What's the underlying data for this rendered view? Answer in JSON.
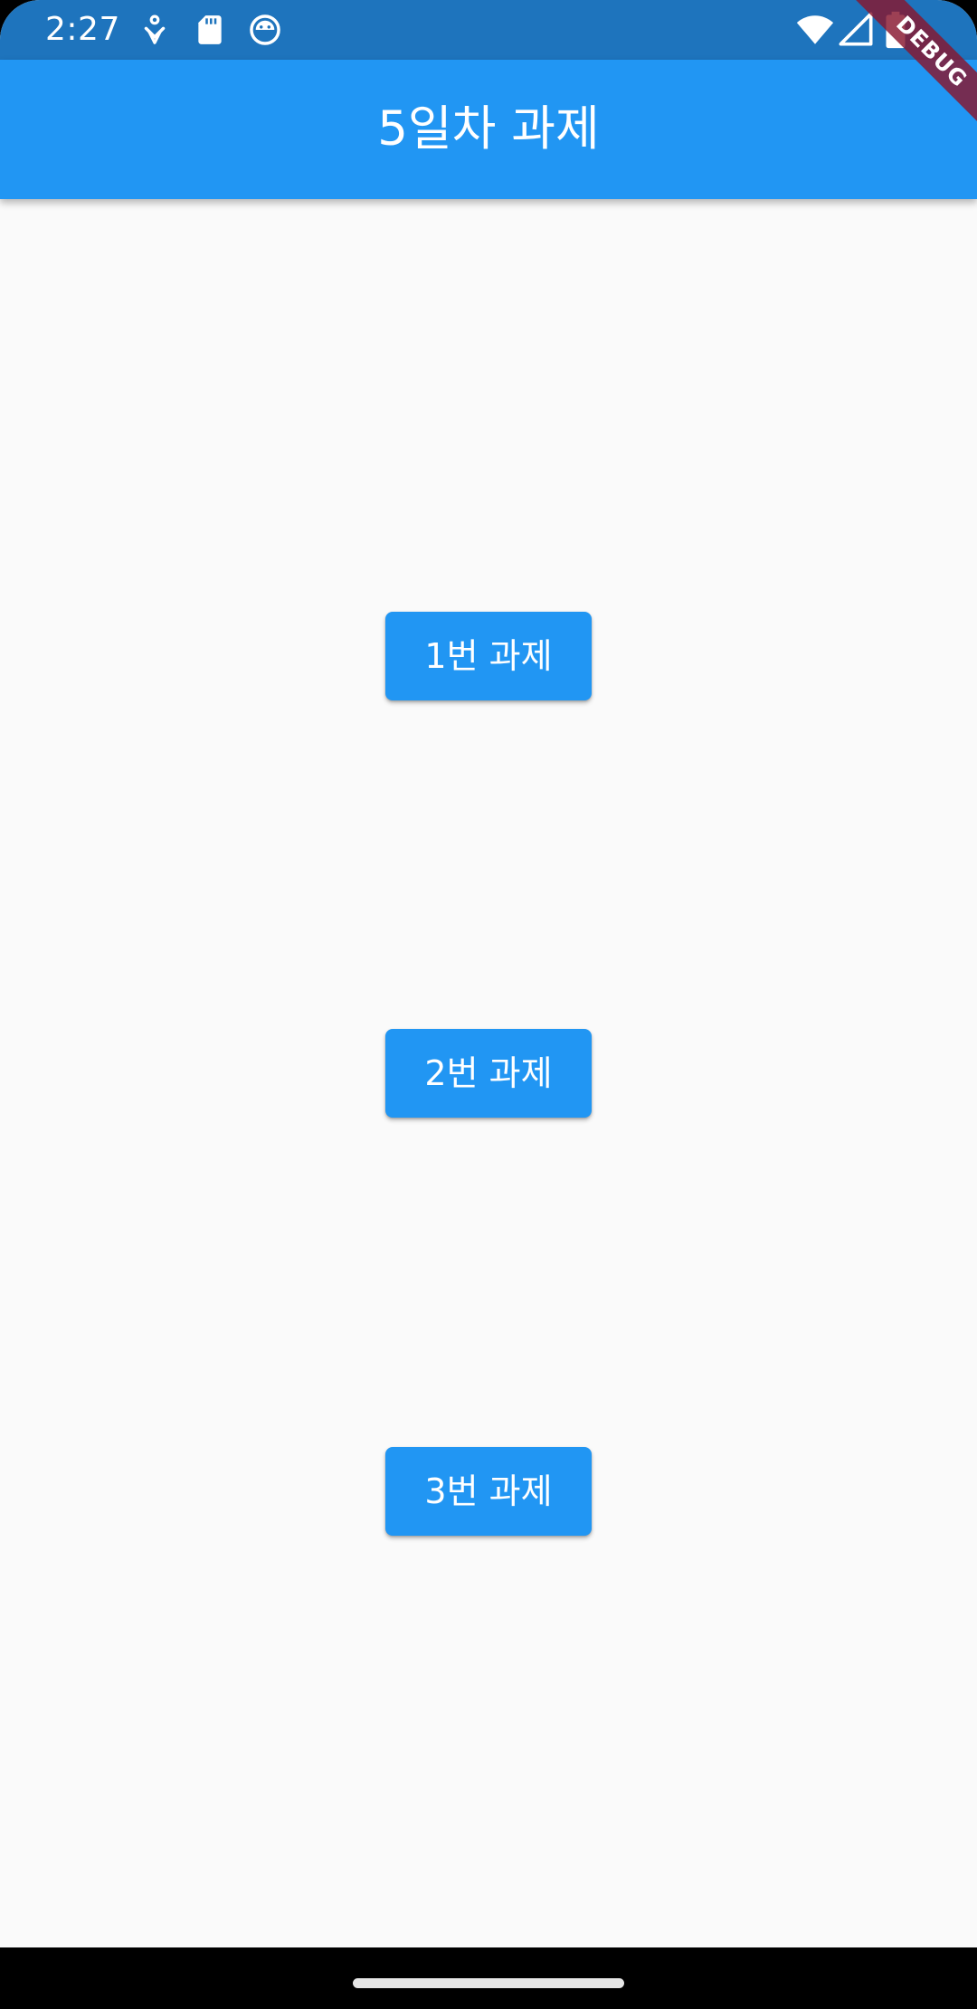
{
  "status_bar": {
    "time": "2:27",
    "left_icons": [
      "tasks-icon",
      "sd-card-icon",
      "face-icon"
    ],
    "right_icons": [
      "wifi-icon",
      "signal-icon",
      "battery-icon"
    ]
  },
  "app_bar": {
    "title": "5일차 과제"
  },
  "debug_banner": {
    "label": "DEBUG"
  },
  "buttons": [
    {
      "label": "1번 과제"
    },
    {
      "label": "2번 과제"
    },
    {
      "label": "3번 과제"
    }
  ],
  "colors": {
    "status_bar": "#1e74bd",
    "app_bar": "#2196f3",
    "button": "#2196f3",
    "background": "#fafafa",
    "debug_banner": "#87162e"
  }
}
